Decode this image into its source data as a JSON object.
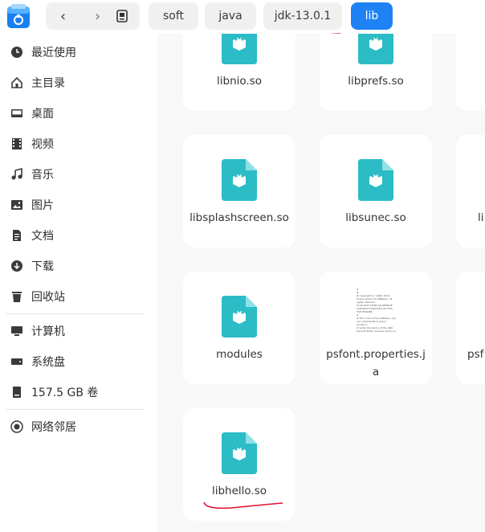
{
  "topbar": {
    "nav_back": "‹",
    "nav_forward": "›",
    "breadcrumbs": [
      "soft",
      "java",
      "jdk-13.0.1",
      "lib"
    ]
  },
  "sidebar": {
    "items": [
      {
        "label": "最近使用",
        "icon": "clock-icon"
      },
      {
        "label": "主目录",
        "icon": "home-icon"
      },
      {
        "label": "桌面",
        "icon": "desktop-icon"
      },
      {
        "label": "视频",
        "icon": "video-icon"
      },
      {
        "label": "音乐",
        "icon": "music-icon"
      },
      {
        "label": "图片",
        "icon": "picture-icon"
      },
      {
        "label": "文档",
        "icon": "document-icon"
      },
      {
        "label": "下载",
        "icon": "download-icon"
      },
      {
        "label": "回收站",
        "icon": "trash-icon"
      }
    ],
    "devices": [
      {
        "label": "计算机",
        "icon": "computer-icon"
      },
      {
        "label": "系统盘",
        "icon": "drive-icon"
      },
      {
        "label": "157.5 GB 卷",
        "icon": "drive-icon"
      }
    ],
    "network": [
      {
        "label": "网络邻居",
        "icon": "network-icon"
      }
    ]
  },
  "files": [
    {
      "name": "libnio.so"
    },
    {
      "name": "libprefs.so"
    },
    {
      "name": "libsplashscreen.so"
    },
    {
      "name": "libsunec.so"
    },
    {
      "name": "li"
    },
    {
      "name": "modules"
    },
    {
      "name": "psfont.properties.ja"
    },
    {
      "name": "psf"
    },
    {
      "name": "libhello.so"
    }
  ],
  "doc_preview_lines": [
    "#",
    "#",
    "# Copyright (c) 1996, 2013,",
    "Oracle and/or its affiliates. All",
    "rights reserved.",
    "# DO NOT ALTER OR REMOVE",
    "COPYRIGHT NOTICES OR THIS",
    "FILE HEADER.",
    "#",
    "# This code is free software; you",
    "can redistribute it and/or",
    "modify it",
    "# under the terms of the GNU",
    "General Public License version 2"
  ],
  "colors": {
    "accent": "#1e82f5",
    "file_icon_teal": "#2bbcc6",
    "annotation_red": "#e0102a"
  }
}
